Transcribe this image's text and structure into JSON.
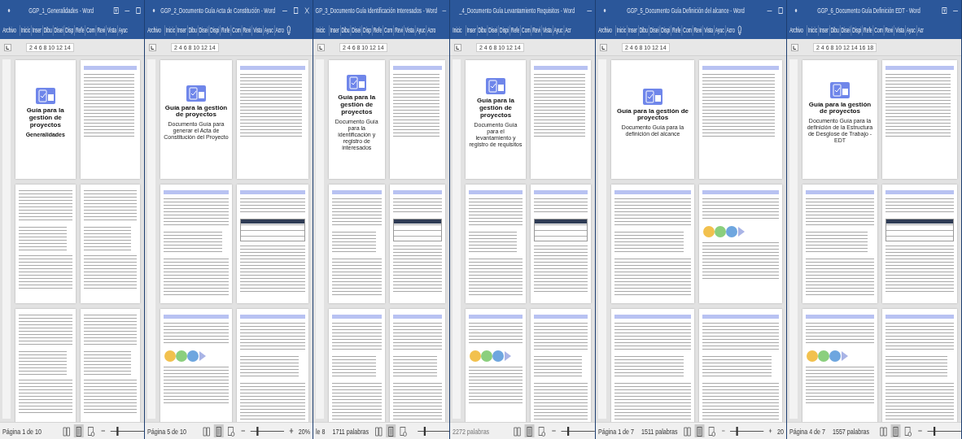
{
  "windows": [
    {
      "title": "GGP_1_Generalidades - Word",
      "quick_access": true,
      "controls": [
        {
          "kind": "ribbon"
        },
        {
          "kind": "minimize"
        },
        {
          "kind": "maximize"
        }
      ],
      "tabs": [
        "Archivo",
        "Inicic",
        "Inser",
        "Dibu",
        "Disei",
        "Disp",
        "Refe",
        "Com",
        "Revi",
        "Vista",
        "Ayuc"
      ],
      "tell_me": false,
      "ruler": "2 4 6 8 10 12 14",
      "pages": [
        {
          "kind": "cover",
          "title": "Guía para la gestión de proyectos",
          "subtitle": "Generalidades"
        },
        {
          "kind": "toc"
        },
        {
          "kind": "plain"
        },
        {
          "kind": "plain"
        },
        {
          "kind": "plain"
        },
        {
          "kind": "plain"
        }
      ],
      "status": {
        "texts": [
          {
            "text": "Página 1 de 10",
            "dim": false
          }
        ],
        "views": [
          {
            "kind": "read",
            "selected": false
          },
          {
            "kind": "print",
            "selected": true
          },
          {
            "kind": "web",
            "selected": false
          }
        ],
        "zoom": {
          "level": 0.2
        },
        "zoom_in": false
      }
    },
    {
      "title": "GGP_2_Documento Guía Acta de Constitución - Word",
      "quick_access": true,
      "controls": [
        {
          "kind": "minimize"
        },
        {
          "kind": "maximize"
        },
        {
          "kind": "close"
        }
      ],
      "tabs": [
        "Archivo",
        "Inicic",
        "Inser",
        "Dibu",
        "Disei",
        "Dispi",
        "Refe",
        "Com",
        "Revi",
        "Vista",
        "Ayuc",
        "Acro"
      ],
      "tell_me": true,
      "ruler": "2 4 6 8 10 12 14",
      "pages": [
        {
          "kind": "cover",
          "title": "Guía para la gestión de proyectos",
          "subtitle": "Documento Guía para generar el Acta de Constitución del Proyecto"
        },
        {
          "kind": "toc"
        },
        {
          "kind": "text"
        },
        {
          "kind": "table"
        },
        {
          "kind": "diagram"
        },
        {
          "kind": "text"
        }
      ],
      "status": {
        "texts": [
          {
            "text": "Página 5 de 10",
            "dim": false
          }
        ],
        "views": [
          {
            "kind": "read",
            "selected": false
          },
          {
            "kind": "print",
            "selected": true
          },
          {
            "kind": "web",
            "selected": false
          }
        ],
        "zoom": {
          "level": 0.2
        },
        "zoom_in": true,
        "zoom_reading": "20%"
      }
    },
    {
      "title": "GP_3_Documento Guía Identificación Interesados - Word",
      "quick_access": false,
      "controls": [
        {
          "kind": "minimize"
        }
      ],
      "tabs": [
        "Inicic",
        "Inser",
        "Dibu",
        "Disei",
        "Disp",
        "Refe",
        "Com",
        "Revi",
        "Vista",
        "Ayuc",
        "Acro"
      ],
      "tell_me": false,
      "ruler": "2 4 6 8 10 12 14",
      "pages": [
        {
          "kind": "cover",
          "title": "Guía para la gestión de proyectos",
          "subtitle": "Documento Guía para la identificación y registro de interesados"
        },
        {
          "kind": "toc"
        },
        {
          "kind": "text"
        },
        {
          "kind": "table"
        },
        {
          "kind": "text"
        },
        {
          "kind": "text"
        }
      ],
      "status": {
        "texts": [
          {
            "text": "le 8",
            "dim": false
          },
          {
            "text": "1711 palabras",
            "dim": false
          }
        ],
        "views": [
          {
            "kind": "read",
            "selected": false
          },
          {
            "kind": "print",
            "selected": true
          },
          {
            "kind": "web",
            "selected": false
          }
        ],
        "zoom": {
          "level": 0.2
        },
        "zoom_in": false
      }
    },
    {
      "title": "_4_Documento Guía Levantamiento Requisitos - Word",
      "quick_access": false,
      "controls": [
        {
          "kind": "minimize"
        }
      ],
      "tabs": [
        "Inicic",
        "Inser",
        "Dibu",
        "Disei",
        "Dispi",
        "Refe",
        "Com",
        "Revi",
        "Vista",
        "Ayuc",
        "Acr"
      ],
      "tell_me": false,
      "ruler": "2 4 6 8 10 12 14",
      "pages": [
        {
          "kind": "cover",
          "title": "Guía para la gestión de proyectos",
          "subtitle": "Documento Guía para el levantamiento y registro de requisitos"
        },
        {
          "kind": "toc"
        },
        {
          "kind": "text"
        },
        {
          "kind": "table"
        },
        {
          "kind": "diagram"
        },
        {
          "kind": "text"
        }
      ],
      "status": {
        "texts": [
          {
            "text": "2272 palabras",
            "dim": true
          }
        ],
        "views": [
          {
            "kind": "read",
            "selected": false
          },
          {
            "kind": "print",
            "selected": true
          },
          {
            "kind": "web",
            "selected": false
          }
        ],
        "zoom": {
          "level": 0.2
        },
        "zoom_in": false
      }
    },
    {
      "title": "GGP_5_Documento Guía Definición del alcance - Word",
      "quick_access": true,
      "controls": [
        {
          "kind": "minimize"
        },
        {
          "kind": "maximize"
        }
      ],
      "tabs": [
        "Archivo",
        "Inicic",
        "Inser",
        "Dibu",
        "Disei",
        "Dispi",
        "Refe",
        "Com",
        "Revi",
        "Vista",
        "Ayuc",
        "Acro"
      ],
      "tell_me": true,
      "ruler": "2 4 6 8 10 12 14",
      "pages": [
        {
          "kind": "cover",
          "title": "Guía para la gestión de proyectos",
          "subtitle": "Documento Guía para la definición del alcance"
        },
        {
          "kind": "toc"
        },
        {
          "kind": "text"
        },
        {
          "kind": "diagram"
        },
        {
          "kind": "text"
        },
        {
          "kind": "text"
        }
      ],
      "status": {
        "texts": [
          {
            "text": "Página 1 de 7",
            "dim": false
          },
          {
            "text": "1511 palabras",
            "dim": false
          }
        ],
        "views": [
          {
            "kind": "read",
            "selected": false
          },
          {
            "kind": "print",
            "selected": true
          },
          {
            "kind": "web",
            "selected": false
          }
        ],
        "zoom": {
          "level": 0.2
        },
        "zoom_in": true,
        "zoom_reading": "20"
      }
    },
    {
      "title": "GGP_6_Documento Guía Definición EDT - Word",
      "quick_access": true,
      "controls": [
        {
          "kind": "ribbon"
        },
        {
          "kind": "minimize"
        }
      ],
      "tabs": [
        "Archivo",
        "Inicic",
        "Inser",
        "Dibu",
        "Disei",
        "Dispi",
        "Refe",
        "Com",
        "Revi",
        "Vista",
        "Ayuc",
        "Acr"
      ],
      "tell_me": false,
      "ruler": "2 4 6 8 10 12 14 16 18",
      "pages": [
        {
          "kind": "cover",
          "title": "Guía para la gestión de proyectos",
          "subtitle": "Documento Guía para la definición de la Estructura de Desglose de Trabajo - EDT"
        },
        {
          "kind": "toc"
        },
        {
          "kind": "text"
        },
        {
          "kind": "table"
        },
        {
          "kind": "diagram"
        },
        {
          "kind": "text"
        }
      ],
      "status": {
        "texts": [
          {
            "text": "Página 4 de 7",
            "dim": false
          },
          {
            "text": "1557 palabras",
            "dim": false
          }
        ],
        "views": [
          {
            "kind": "read",
            "selected": false
          },
          {
            "kind": "print",
            "selected": true
          },
          {
            "kind": "web",
            "selected": false
          }
        ],
        "zoom": {
          "level": 0.2
        },
        "zoom_in": false
      }
    }
  ]
}
